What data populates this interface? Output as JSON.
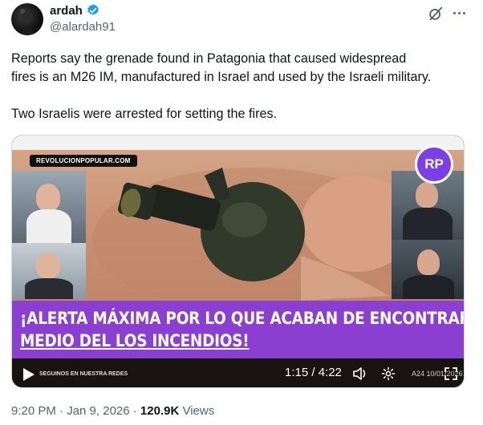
{
  "author": {
    "display_name": "ardah",
    "handle": "@alardah91",
    "verified": true,
    "avatar_icon": "avatar-image"
  },
  "header_actions": {
    "grok_icon": "grok-icon",
    "more_icon": "more-icon"
  },
  "tweet": {
    "paragraphs": [
      "Reports say the grenade found in Patagonia that caused widespread",
      "fires is an M26 IM, manufactured in Israel and used by the Israeli military.",
      "Two Israelis were arrested for setting the fires."
    ]
  },
  "video": {
    "channel_tag": "REVOLUCIONPOPULAR.COM",
    "badge": "RP",
    "headline_line1": "¡ALERTA MÁXIMA POR LO QUE ACABAN DE ENCONTRAR EN CHUBUT EN",
    "headline_line2": "MEDIO DEL LOS INCENDIOS!",
    "ticker": "SEGUINOS EN NUESTRA REDES",
    "time": "1:15 / 4:22",
    "overlay_date": "A24 10/01/2026",
    "accent_color": "#8a3fd0"
  },
  "meta": {
    "timestamp": "9:20 PM · Jan 9, 2026 · ",
    "views_count": "120.9K",
    "views_label": " Views"
  },
  "colors": {
    "text": "#0f1419",
    "secondary": "#536471",
    "verified": "#1d9bf0"
  }
}
